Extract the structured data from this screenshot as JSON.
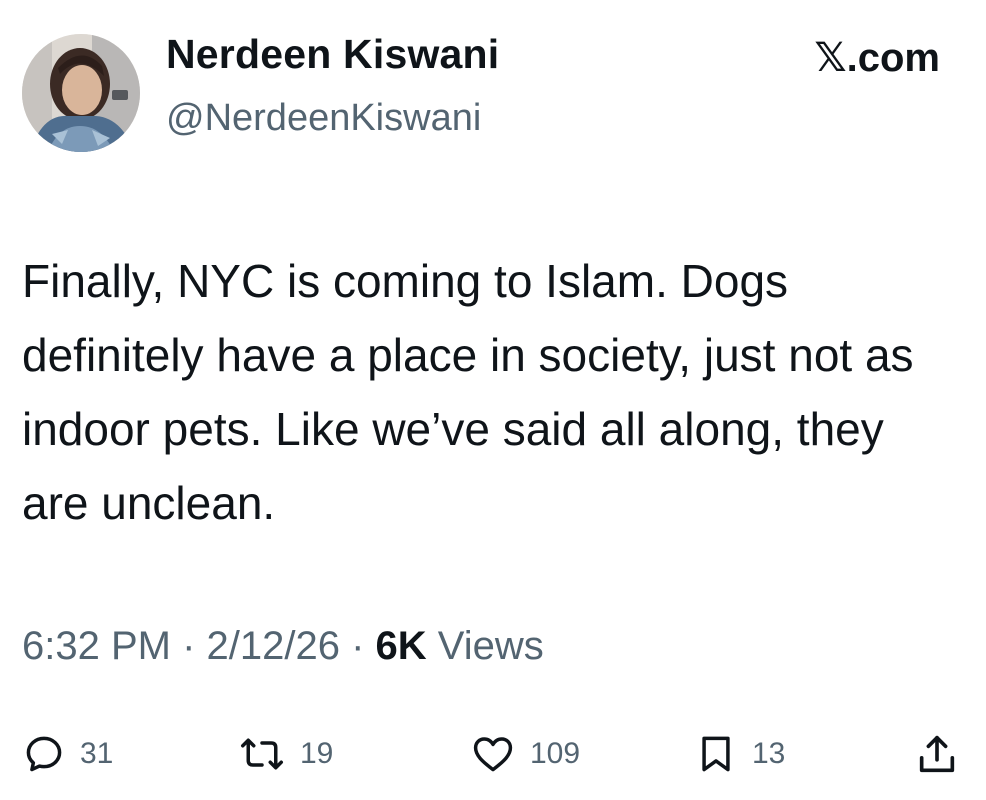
{
  "tweet": {
    "author": {
      "display_name": "Nerdeen Kiswani",
      "handle": "@NerdeenKiswani"
    },
    "brand": "𝕏.com",
    "text": "Finally, NYC is coming to Islam. Dogs definitely have a place in society, just not as indoor pets. Like we’ve said all along, they are unclean.",
    "time": "6:32 PM",
    "date": "2/12/26",
    "separator": " · ",
    "views_count": "6K",
    "views_label": " Views"
  },
  "actions": {
    "reply": {
      "icon": "reply-icon",
      "count": "31"
    },
    "repost": {
      "icon": "repost-icon",
      "count": "19"
    },
    "like": {
      "icon": "heart-icon",
      "count": "109"
    },
    "bookmark": {
      "icon": "bookmark-icon",
      "count": "13"
    },
    "share": {
      "icon": "share-icon"
    }
  },
  "colors": {
    "text_primary": "#0f1419",
    "text_secondary": "#536471",
    "background": "#ffffff"
  }
}
